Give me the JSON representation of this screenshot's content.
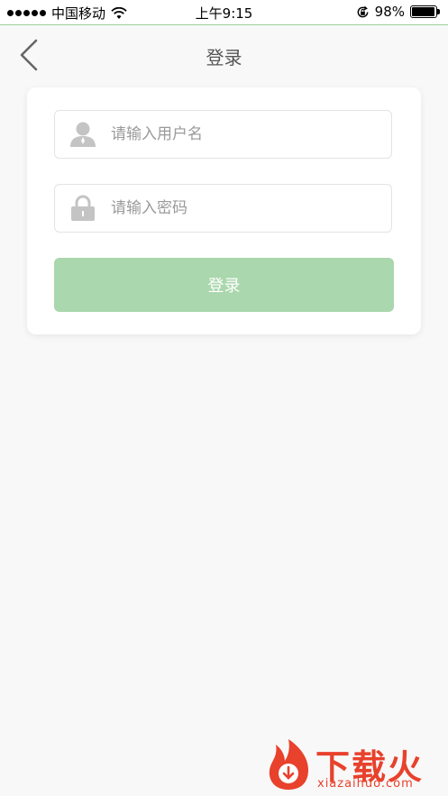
{
  "status_bar": {
    "carrier": "中国移动",
    "time": "上午9:15",
    "battery_percent": "98%",
    "battery_level": 0.98
  },
  "nav": {
    "title": "登录",
    "back_icon": "chevron-left-icon"
  },
  "form": {
    "username": {
      "placeholder": "请输入用户名",
      "value": "",
      "icon": "user-icon"
    },
    "password": {
      "placeholder": "请输入密码",
      "value": "",
      "icon": "lock-icon"
    },
    "submit_label": "登录"
  },
  "watermark": {
    "text": "下载火",
    "url": "xiazaihuo.com"
  },
  "colors": {
    "accent": "#aad7ad",
    "background": "#f8f8f8",
    "watermark": "#e8412c"
  }
}
